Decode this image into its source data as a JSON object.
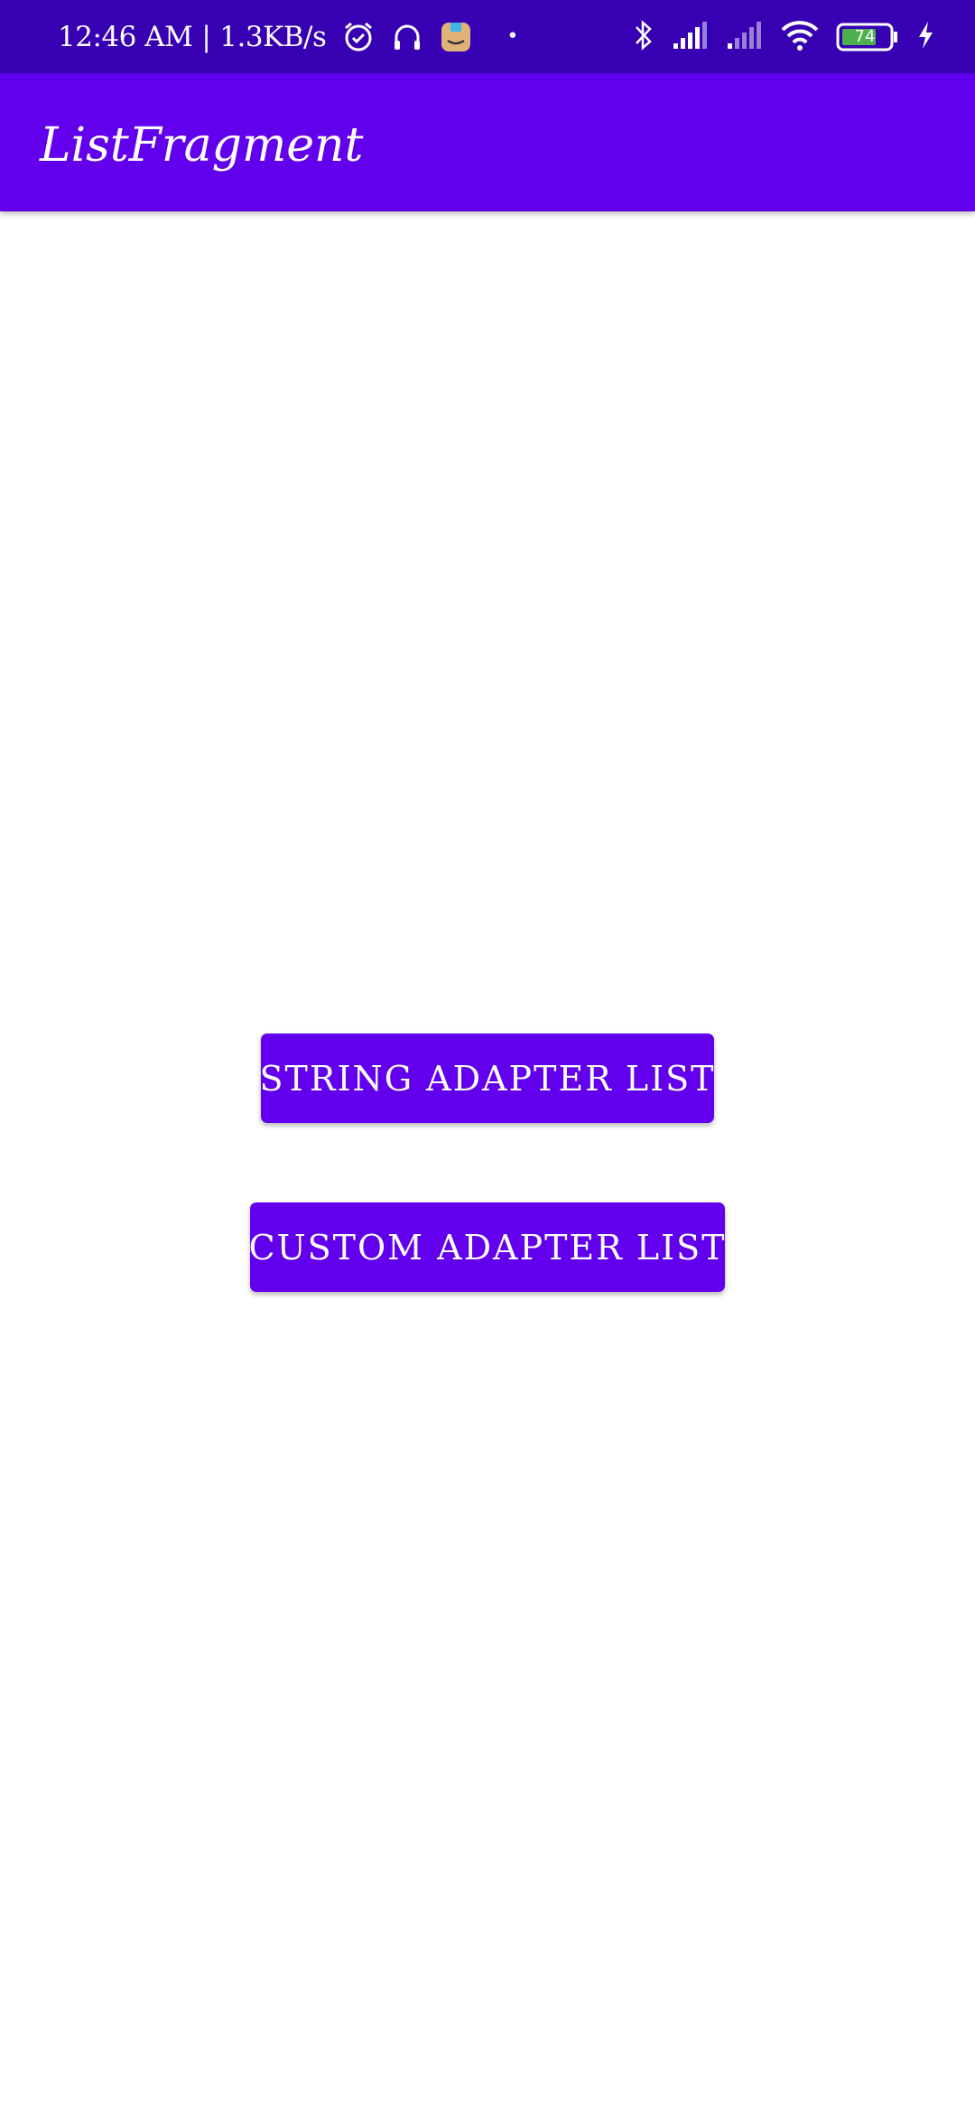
{
  "status_bar": {
    "time": "12:46 AM",
    "separator": "|",
    "network_speed": "1.3KB/s",
    "dot": "•",
    "battery_level": "74",
    "icons": [
      "alarm-icon",
      "headset-icon",
      "amazon-app-icon",
      "bluetooth-icon",
      "signal-icon",
      "signal-weak-icon",
      "wifi-icon",
      "battery-icon",
      "charging-icon"
    ],
    "bg_color": "#3700b3"
  },
  "app_bar": {
    "title": "ListFragment",
    "bg_color": "#6200ee"
  },
  "buttons": {
    "string_adapter": "STRING ADAPTER LIST",
    "custom_adapter": "CUSTOM ADAPTER LIST",
    "bg_color": "#6200ee"
  }
}
